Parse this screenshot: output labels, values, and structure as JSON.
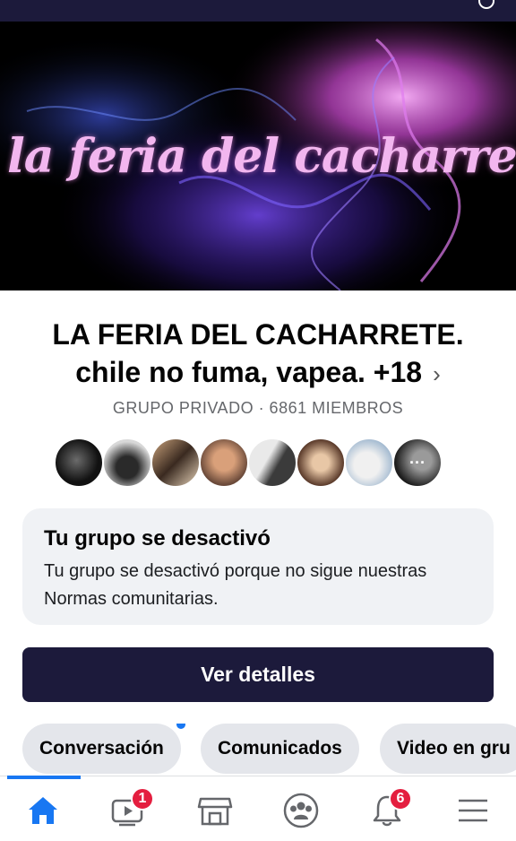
{
  "cover": {
    "title": "la feria del cacharrete."
  },
  "group": {
    "name_line1": "LA FERIA DEL CACHARRETE.",
    "name_line2": "chile no fuma, vapea. +18",
    "chevron": "›",
    "meta": "GRUPO PRIVADO · 6861 MIEMBROS",
    "members_more": "···"
  },
  "notice": {
    "title": "Tu grupo se desactivó",
    "body": "Tu grupo se desactivó porque no sigue nuestras Normas comunitarias."
  },
  "details_button": "Ver detalles",
  "tabs": [
    {
      "label": "Conversación",
      "has_dot": true
    },
    {
      "label": "Comunicados"
    },
    {
      "label": "Video en gru"
    }
  ],
  "bottom_nav": {
    "items": [
      {
        "name": "home-icon",
        "active": true
      },
      {
        "name": "video-icon",
        "badge": "1"
      },
      {
        "name": "marketplace-icon"
      },
      {
        "name": "groups-icon"
      },
      {
        "name": "notifications-icon",
        "badge": "6"
      },
      {
        "name": "menu-icon"
      }
    ]
  },
  "colors": {
    "brand_dark": "#1c1a3b",
    "accent": "#1877f2",
    "badge": "#e41e3f",
    "cover_text": "#f2b6ef"
  }
}
